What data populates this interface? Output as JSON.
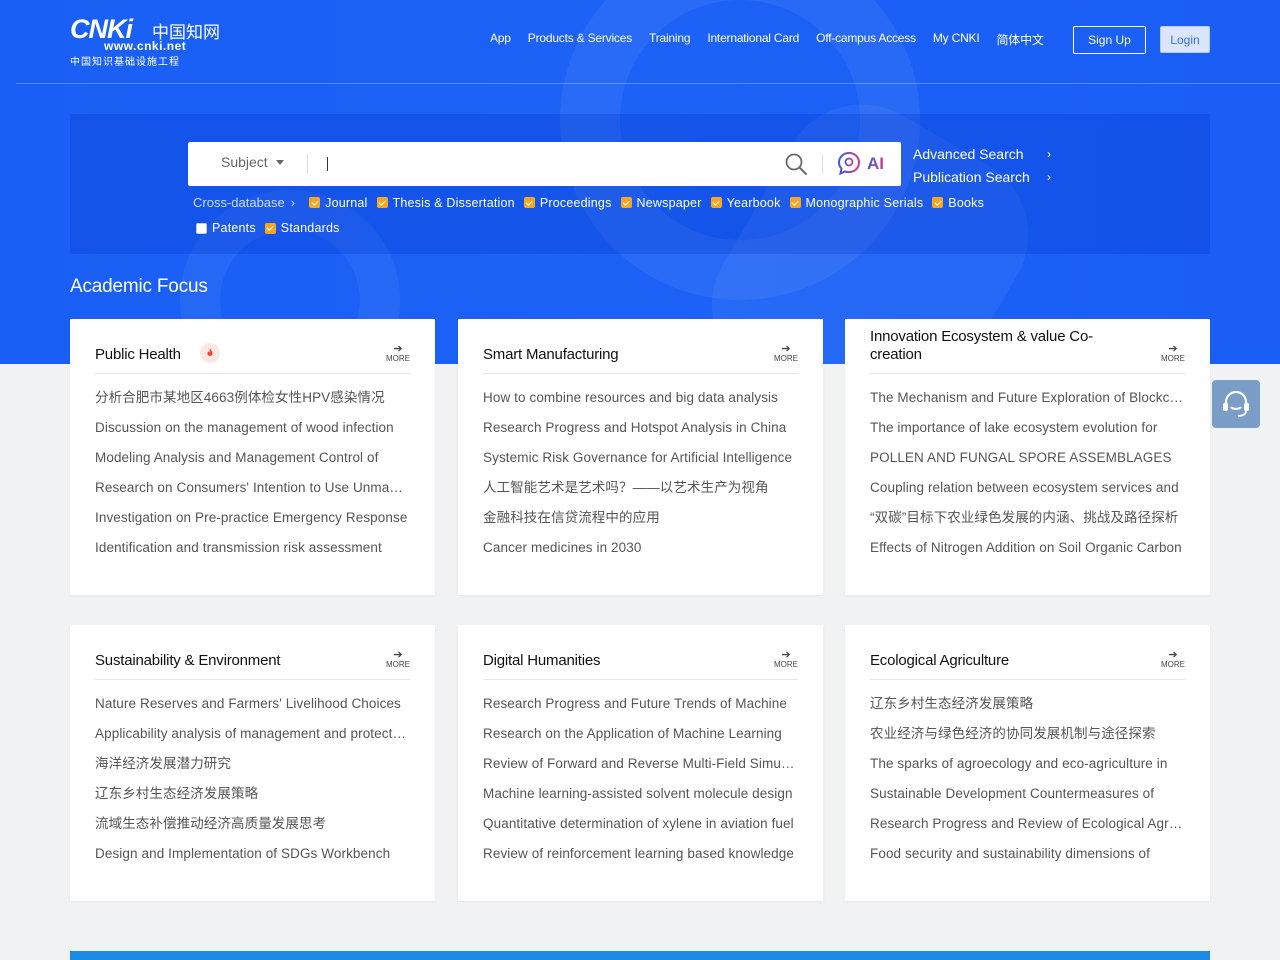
{
  "header": {
    "logo": {
      "brand": "CNKi",
      "brand_cn": "中国知网",
      "url": "www.cnki.net",
      "subtitle": "中国知识基础设施工程"
    },
    "nav": [
      "App",
      "Products & Services",
      "Training",
      "International Card",
      "Off-campus Access",
      "My CNKI",
      "简体中文"
    ],
    "signup_label": "Sign Up",
    "login_label": "Login"
  },
  "search": {
    "subject_label": "Subject",
    "input_value": "",
    "ai_label": "AI",
    "advanced_search": "Advanced Search",
    "publication_search": "Publication Search",
    "cross_database": "Cross-database",
    "databases": [
      {
        "label": "Journal",
        "checked": true
      },
      {
        "label": "Thesis & Dissertation",
        "checked": true
      },
      {
        "label": "Proceedings",
        "checked": true
      },
      {
        "label": "Newspaper",
        "checked": true
      },
      {
        "label": "Yearbook",
        "checked": true
      },
      {
        "label": "Monographic Serials",
        "checked": true
      },
      {
        "label": "Books",
        "checked": true
      },
      {
        "label": "Patents",
        "checked": false
      },
      {
        "label": "Standards",
        "checked": true
      }
    ]
  },
  "section_title": "Academic Focus",
  "more_label": "MORE",
  "cards": [
    {
      "title": "Public Health",
      "hot": true,
      "items": [
        "分析合肥市某地区4663例体检女性HPV感染情况",
        "Discussion on the management of wood infection",
        "Modeling Analysis and Management Control of",
        "Research on Consumers' Intention to Use Unmanned",
        "Investigation on Pre-practice Emergency Response",
        "Identification and transmission risk assessment"
      ]
    },
    {
      "title": "Smart Manufacturing",
      "items": [
        "How to combine resources and big data analysis",
        "Research Progress and Hotspot Analysis in China",
        "Systemic Risk Governance for Artificial Intelligence",
        "人工智能艺术是艺术吗？——以艺术生产为视角",
        "金融科技在信贷流程中的应用",
        "Cancer medicines in 2030"
      ]
    },
    {
      "title": "Innovation Ecosystem & value Co-creation",
      "items": [
        "The Mechanism and Future Exploration of Blockchain",
        "The importance of lake ecosystem evolution for",
        "POLLEN AND FUNGAL SPORE ASSEMBLAGES",
        "Coupling relation between ecosystem services and",
        "“双碳”目标下农业绿色发展的内涵、挑战及路径探析",
        "Effects of Nitrogen Addition on Soil Organic Carbon"
      ]
    },
    {
      "title": "Sustainability & Environment",
      "items": [
        "Nature Reserves and Farmers' Livelihood Choices",
        "Applicability analysis of management and protection",
        "海洋经济发展潜力研究",
        "辽东乡村生态经济发展策略",
        "流域生态补偿推动经济高质量发展思考",
        "Design and Implementation of SDGs Workbench"
      ]
    },
    {
      "title": "Digital Humanities",
      "items": [
        "Research Progress and Future Trends of Machine",
        "Research on the Application of Machine Learning",
        "Review of Forward and Reverse Multi-Field Simulation",
        "Machine learning-assisted solvent molecule design",
        "Quantitative determination of xylene in aviation fuel",
        "Review of reinforcement learning based knowledge"
      ]
    },
    {
      "title": "Ecological Agriculture",
      "items": [
        "辽东乡村生态经济发展策略",
        "农业经济与绿色经济的协同发展机制与途径探索",
        "The sparks of agroecology and eco-agriculture in",
        "Sustainable Development Countermeasures of",
        "Research Progress and Review of Ecological Agriculture",
        "Food security and sustainability dimensions of"
      ]
    }
  ]
}
